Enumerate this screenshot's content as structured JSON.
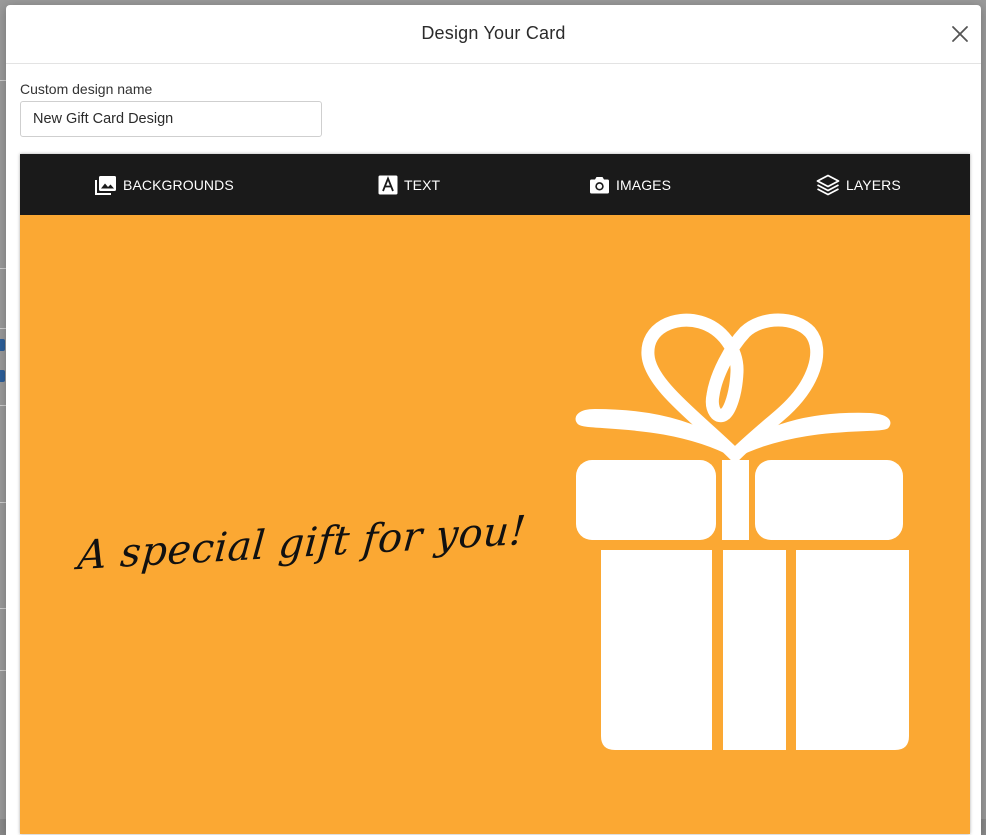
{
  "modal": {
    "title": "Design Your Card"
  },
  "form": {
    "design_name_label": "Custom design name",
    "design_name_value": "New Gift Card Design"
  },
  "toolbar": {
    "items": [
      {
        "label": "BACKGROUNDS",
        "icon": "image-icon"
      },
      {
        "label": "TEXT",
        "icon": "text-a-icon"
      },
      {
        "label": "IMAGES",
        "icon": "camera-icon"
      },
      {
        "label": "LAYERS",
        "icon": "layers-icon"
      }
    ]
  },
  "card": {
    "message": "A special gift for you!",
    "graphic": "gift-box-icon",
    "background_color": "#fba833",
    "message_color": "#111111",
    "graphic_color": "#ffffff"
  },
  "colors": {
    "toolbar_bg": "#1a1a1a",
    "toolbar_text": "#ffffff"
  }
}
